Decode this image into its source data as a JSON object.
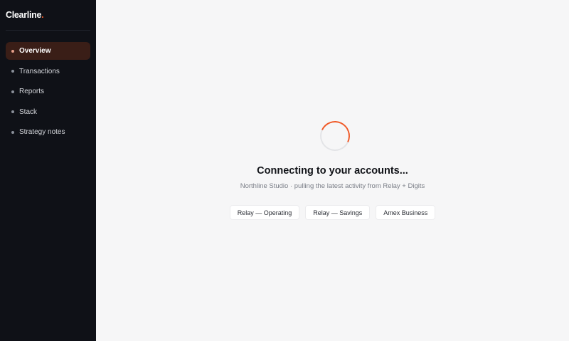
{
  "brand": {
    "name": "Clearline",
    "dot": ".",
    "accent": "#f05a28"
  },
  "sidebar": {
    "items": [
      {
        "label": "Overview",
        "active": true
      },
      {
        "label": "Transactions",
        "active": false
      },
      {
        "label": "Reports",
        "active": false
      },
      {
        "label": "Stack",
        "active": false
      },
      {
        "label": "Strategy notes",
        "active": false
      }
    ]
  },
  "loading": {
    "title": "Connecting to your accounts...",
    "subtitle": "Northline Studio · pulling the latest activity from Relay + Digits",
    "accounts": [
      "Relay — Operating",
      "Relay — Savings",
      "Amex Business"
    ]
  }
}
